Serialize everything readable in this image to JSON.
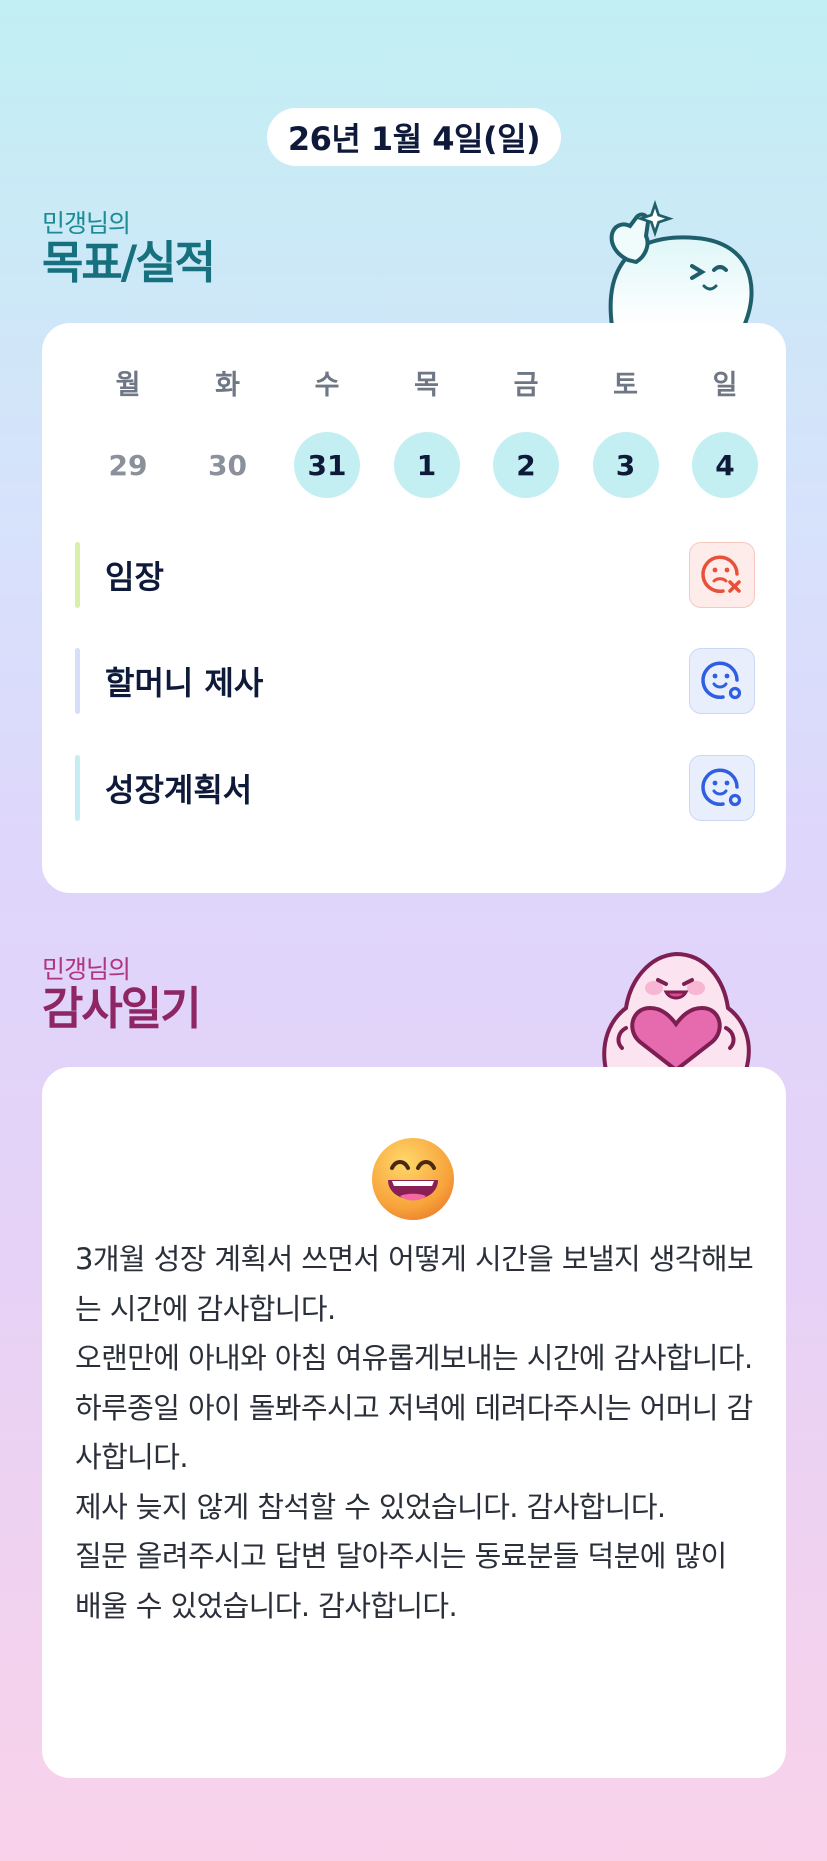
{
  "date_label": "26년 1월 4일(일)",
  "goal_section": {
    "subtitle": "민갱님의",
    "title": "목표/실적",
    "weekdays": [
      "월",
      "화",
      "수",
      "목",
      "금",
      "토",
      "일"
    ],
    "dates": [
      "29",
      "30",
      "31",
      "1",
      "2",
      "3",
      "4"
    ],
    "items": [
      {
        "label": "임장",
        "bar_color": "#d8f0a8",
        "status": "fail",
        "status_icon": "sad-face-x-icon",
        "status_color": "#e8503a"
      },
      {
        "label": "할머니 제사",
        "bar_color": "#d6def8",
        "status": "done",
        "status_icon": "smile-face-check-icon",
        "status_color": "#2f5fe0"
      },
      {
        "label": "성장계획서",
        "bar_color": "#c3eff2",
        "status": "done",
        "status_icon": "smile-face-check-icon",
        "status_color": "#2f5fe0"
      }
    ]
  },
  "thanks_section": {
    "subtitle": "민갱님의",
    "title": "감사일기",
    "emoji_icon": "grinning-face-icon",
    "diary_text": "3개월 성장 계획서 쓰면서 어떻게 시간을 보낼지 생각해보는 시간에 감사합니다.\n오랜만에 아내와 아침 여유롭게보내는 시간에 감사합니다.\n하루종일 아이 돌봐주시고 저녁에 데려다주시는 어머니 감사합니다.\n제사 늦지 않게 참석할 수 있었습니다. 감사합니다.\n질문 올려주시고 답변 달아주시는 동료분들 덕분에 많이 배울 수 있었습니다. 감사합니다."
  },
  "colors": {
    "goal_accent": "#16707e",
    "thanks_accent": "#8e2664",
    "active_date_bg": "#c3eff2"
  }
}
